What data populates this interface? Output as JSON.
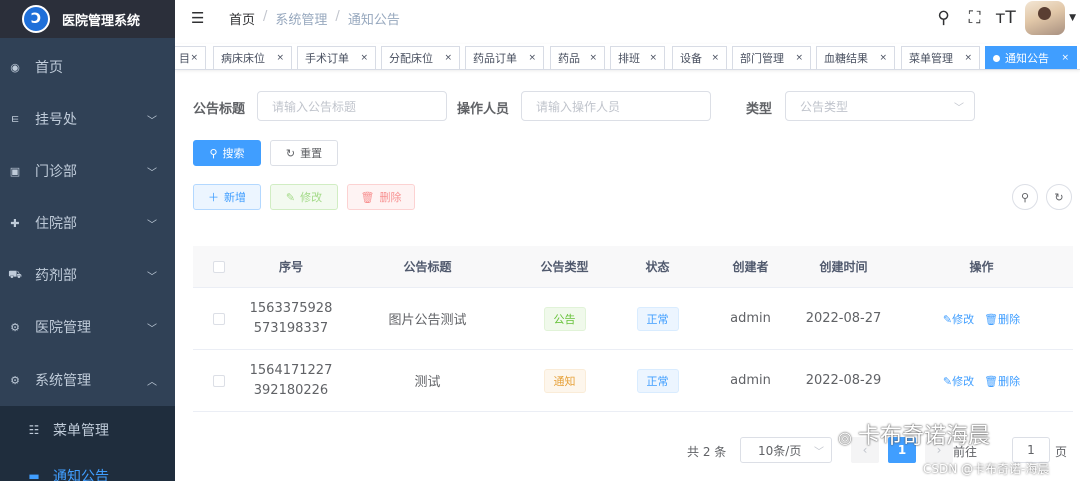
{
  "app": {
    "title": "医院管理系统",
    "logo_icon": "hospital-logo-icon"
  },
  "sidebar": {
    "items": [
      {
        "label": "首页",
        "icon": "dashboard-icon",
        "expandable": false
      },
      {
        "label": "挂号处",
        "icon": "register-icon",
        "expandable": true
      },
      {
        "label": "门诊部",
        "icon": "clinic-icon",
        "expandable": true
      },
      {
        "label": "住院部",
        "icon": "inpatient-icon",
        "expandable": true
      },
      {
        "label": "药剂部",
        "icon": "cart-icon",
        "expandable": true
      },
      {
        "label": "医院管理",
        "icon": "gear-icon",
        "expandable": true
      },
      {
        "label": "系统管理",
        "icon": "gear-icon",
        "expandable": true,
        "expanded": true
      }
    ],
    "subitems": [
      {
        "label": "菜单管理",
        "icon": "tree-table-icon"
      },
      {
        "label": "通知公告",
        "icon": "message-icon",
        "active": true
      }
    ]
  },
  "navbar": {
    "breadcrumb": [
      "首页",
      "系统管理",
      "通知公告"
    ],
    "icons": [
      "search-icon",
      "fullscreen-icon",
      "font-size-icon"
    ]
  },
  "tags": [
    "目",
    "病床床位",
    "手术订单",
    "分配床位",
    "药品订单",
    "药品",
    "排班",
    "设备",
    "部门管理",
    "血糖结果",
    "菜单管理",
    "通知公告"
  ],
  "active_tag": "通知公告",
  "search_form": {
    "title_label": "公告标题",
    "title_placeholder": "请输入公告标题",
    "operator_label": "操作人员",
    "operator_placeholder": "请输入操作人员",
    "type_label": "类型",
    "type_placeholder": "公告类型",
    "search_btn": "搜索",
    "reset_btn": "重置"
  },
  "toolbar": {
    "add": "新增",
    "edit": "修改",
    "delete": "删除"
  },
  "table": {
    "headers": [
      "序号",
      "公告标题",
      "公告类型",
      "状态",
      "创建者",
      "创建时间",
      "操作"
    ],
    "rows": [
      {
        "id_line1": "1563375928",
        "id_line2": "573198337",
        "title": "图片公告测试",
        "type": "公告",
        "type_color": "success",
        "status": "正常",
        "creator": "admin",
        "created": "2022-08-27",
        "edit": "修改",
        "delete": "删除"
      },
      {
        "id_line1": "1564171227",
        "id_line2": "392180226",
        "title": "测试",
        "type": "通知",
        "type_color": "warning",
        "status": "正常",
        "creator": "admin",
        "created": "2022-08-29",
        "edit": "修改",
        "delete": "删除"
      }
    ]
  },
  "pagination": {
    "total": "共 2 条",
    "page_size": "10条/页",
    "current": "1",
    "goto": "前往",
    "goto_value": "1",
    "page_suffix": "页"
  },
  "watermark": {
    "line1": "卡布奇诺海晨",
    "line2": "CSDN @卡布奇诺-海晨"
  },
  "colors": {
    "sidebar": "#304156",
    "primary": "#409eff",
    "success": "#67c23a",
    "warning": "#e6a23c",
    "danger": "#f56c6c"
  }
}
